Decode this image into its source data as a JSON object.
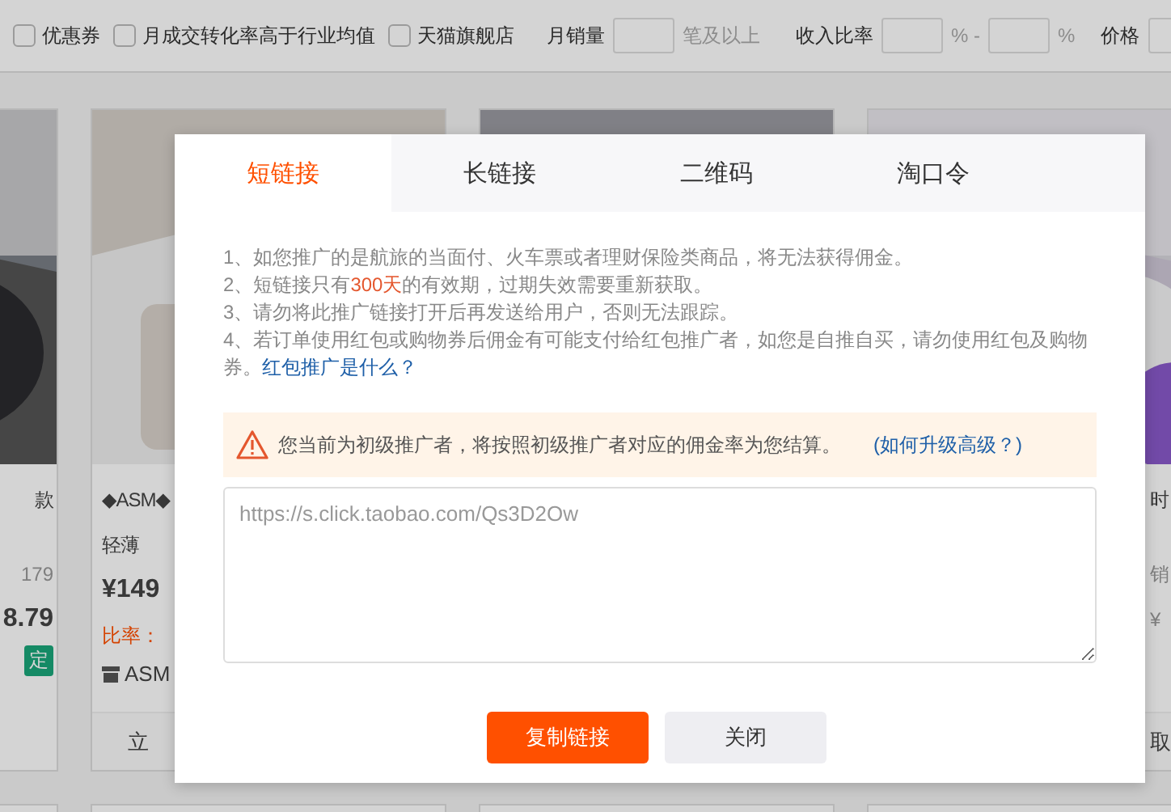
{
  "filters": {
    "checkboxes": [
      {
        "label": "优惠券",
        "checked": false
      },
      {
        "label": "月成交转化率高于行业均值",
        "checked": false
      },
      {
        "label": "天猫旗舰店",
        "checked": false
      }
    ],
    "sales": {
      "label": "月销量",
      "suffix": "笔及以上"
    },
    "ratio": {
      "label": "收入比率",
      "unit_1": "% -",
      "unit_2": "%"
    },
    "price": {
      "label": "价格"
    }
  },
  "products": [
    {
      "kind": "cut_left",
      "lines": [
        {
          "kind": "title",
          "text": "款"
        },
        {
          "kind": "gap"
        },
        {
          "kind": "old_price",
          "text": "179"
        },
        {
          "kind": "price",
          "text": "8.79"
        },
        {
          "kind": "badge",
          "text": "定"
        }
      ]
    },
    {
      "kind": "full",
      "lines": [
        {
          "kind": "title",
          "text": "◆ASM◆"
        },
        {
          "kind": "title",
          "text": "轻薄"
        },
        {
          "kind": "price",
          "text": "¥149"
        },
        {
          "kind": "rate",
          "text": "比率："
        },
        {
          "kind": "shop",
          "text": "ASM"
        }
      ],
      "action": "立"
    },
    {
      "kind": "full"
    },
    {
      "kind": "cut_right",
      "lines": [
        {
          "kind": "title",
          "text": "时"
        },
        {
          "kind": "gap"
        },
        {
          "kind": "sales",
          "text": "销"
        },
        {
          "kind": "old_price",
          "text": "¥"
        }
      ],
      "action": "取"
    }
  ],
  "dialog": {
    "tabs": [
      {
        "label": "短链接",
        "selected": true
      },
      {
        "label": "长链接",
        "selected": false
      },
      {
        "label": "二维码",
        "selected": false
      },
      {
        "label": "淘口令",
        "selected": false
      }
    ],
    "notes": [
      {
        "text": "1、如您推广的是航旅的当面付、火车票或者理财保险类商品，将无法获得佣金。"
      },
      {
        "text": "2、短链接只有",
        "highlight": "300天",
        "after": "的有效期，过期失效需要重新获取。"
      },
      {
        "text": "3、请勿将此推广链接打开后再发送给用户，否则无法跟踪。"
      },
      {
        "text": "4、若订单使用红包或购物券后佣金有可能支付给红包推广者，如您是自推自买，请勿使用红包及购物券。",
        "link": "红包推广是什么？"
      }
    ],
    "warning": {
      "text": "您当前为初级推广者，将按照初级推广者对应的佣金率为您结算。",
      "link": "(如何升级高级？)"
    },
    "link_value": "https://s.click.taobao.com/Qs3D2Ow",
    "buttons": [
      {
        "label": "复制链接",
        "kind": "primary"
      },
      {
        "label": "关闭",
        "kind": "secondary"
      }
    ]
  }
}
